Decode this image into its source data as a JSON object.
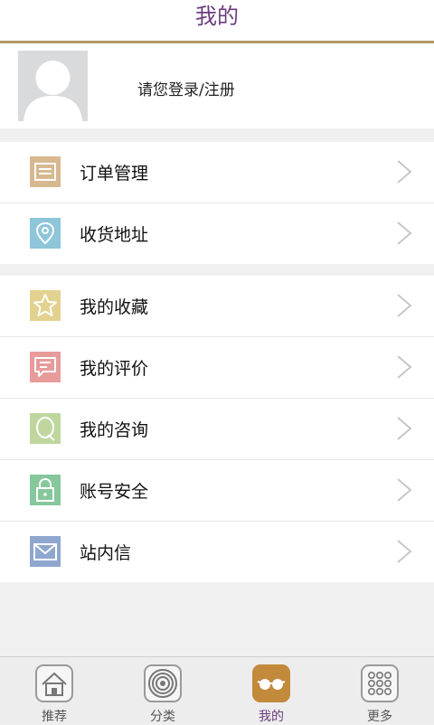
{
  "header": {
    "title": "我的"
  },
  "profile": {
    "login_text": "请您登录/注册"
  },
  "menu_groups": [
    {
      "items": [
        {
          "label": "订单管理",
          "icon": "order-list-icon",
          "color": "#d7b88f"
        },
        {
          "label": "收货地址",
          "icon": "location-pin-icon",
          "color": "#8ec5d9"
        }
      ]
    },
    {
      "items": [
        {
          "label": "我的收藏",
          "icon": "star-icon",
          "color": "#e3d28f"
        },
        {
          "label": "我的评价",
          "icon": "comment-icon",
          "color": "#e79b9b"
        },
        {
          "label": "我的咨询",
          "icon": "consult-icon",
          "color": "#bfd79f"
        },
        {
          "label": "账号安全",
          "icon": "lock-icon",
          "color": "#86c79c"
        },
        {
          "label": "站内信",
          "icon": "mail-icon",
          "color": "#8fa6cf"
        }
      ]
    }
  ],
  "tabbar": {
    "tabs": [
      {
        "label": "推荐",
        "icon": "home-icon",
        "active": false
      },
      {
        "label": "分类",
        "icon": "target-icon",
        "active": false
      },
      {
        "label": "我的",
        "icon": "glasses-icon",
        "active": true
      },
      {
        "label": "更多",
        "icon": "grid-dots-icon",
        "active": false
      }
    ]
  },
  "colors": {
    "accent_gold": "#b59a65",
    "title_purple": "#6b3d7d",
    "active_tab": "#c38a3b"
  }
}
